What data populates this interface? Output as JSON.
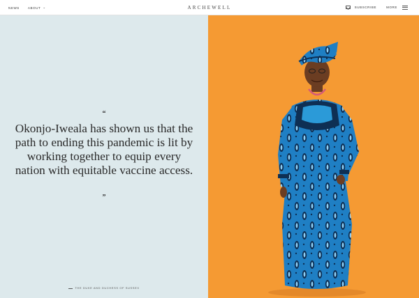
{
  "nav": {
    "news_label": "NEWS",
    "about_label": "ABOUT",
    "brand": "ARCHEWELL",
    "subscribe_label": "SUBSCRIBE",
    "more_label": "MORE"
  },
  "quote": {
    "open_mark": "“",
    "text": "Okonjo-Iweala has shown us that the path to ending this pandemic is lit by working together to equip every nation with equitable vaccine access.",
    "close_mark": "”",
    "attribution": "THE DUKE AND DUCHESS OF SUSSEX"
  },
  "colors": {
    "left_bg": "#dde9ec",
    "right_bg": "#f59a33",
    "dress_blue": "#1f7fc4",
    "dress_dark": "#0e2f54"
  }
}
